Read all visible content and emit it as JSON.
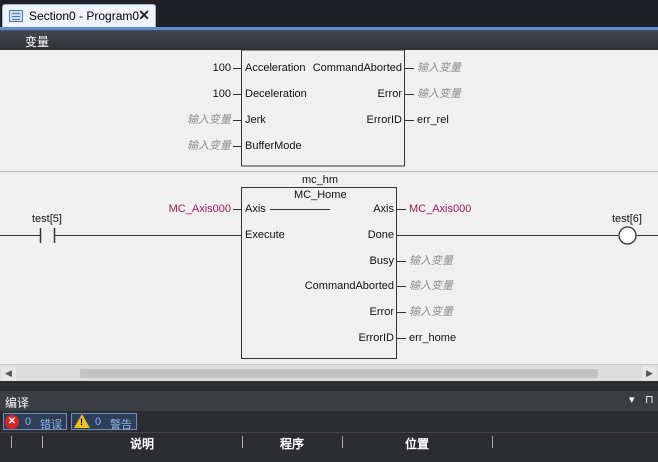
{
  "tab": {
    "title": "Section0 - Program0",
    "close": "✕"
  },
  "variables_header": "变量",
  "block1": {
    "inputs": [
      {
        "pin": "Acceleration",
        "value": "100",
        "placeholder": false
      },
      {
        "pin": "Deceleration",
        "value": "100",
        "placeholder": false
      },
      {
        "pin": "Jerk",
        "value": "输入变量",
        "placeholder": true
      },
      {
        "pin": "BufferMode",
        "value": "输入变量",
        "placeholder": true
      }
    ],
    "outputs": [
      {
        "pin": "CommandAborted",
        "value": "输入变量",
        "placeholder": true
      },
      {
        "pin": "Error",
        "value": "输入变量",
        "placeholder": true
      },
      {
        "pin": "ErrorID",
        "value": "err_rel",
        "placeholder": false
      }
    ]
  },
  "rung2": {
    "contact": "test[5]",
    "coil": "test[6]",
    "instance": "mc_hm",
    "fb_type": "MC_Home",
    "axis_in_value": "MC_Axis000",
    "axis_out_value": "MC_Axis000",
    "inputs": [
      {
        "pin": "Axis"
      },
      {
        "pin": "Execute"
      }
    ],
    "outputs": [
      {
        "pin": "Axis",
        "value": "MC_Axis000",
        "placeholder": false
      },
      {
        "pin": "Done",
        "value": "",
        "placeholder": false
      },
      {
        "pin": "Busy",
        "value": "输入变量",
        "placeholder": true
      },
      {
        "pin": "CommandAborted",
        "value": "输入变量",
        "placeholder": true
      },
      {
        "pin": "Error",
        "value": "输入变量",
        "placeholder": true
      },
      {
        "pin": "ErrorID",
        "value": "err_home",
        "placeholder": false
      }
    ]
  },
  "scrollbar": {
    "left": "◀",
    "right": "▶"
  },
  "compile_panel": {
    "title": "编译",
    "dropdown": "▾",
    "pin": "⊓",
    "errors": {
      "count": "0",
      "label": "错误"
    },
    "warnings": {
      "count": "0",
      "label": "警告"
    },
    "columns": [
      "说明",
      "程序",
      "位置"
    ]
  },
  "colors": {
    "variable": "#a0185a",
    "placeholder": "#8e8e8e",
    "accent": "#5c8ed1"
  }
}
